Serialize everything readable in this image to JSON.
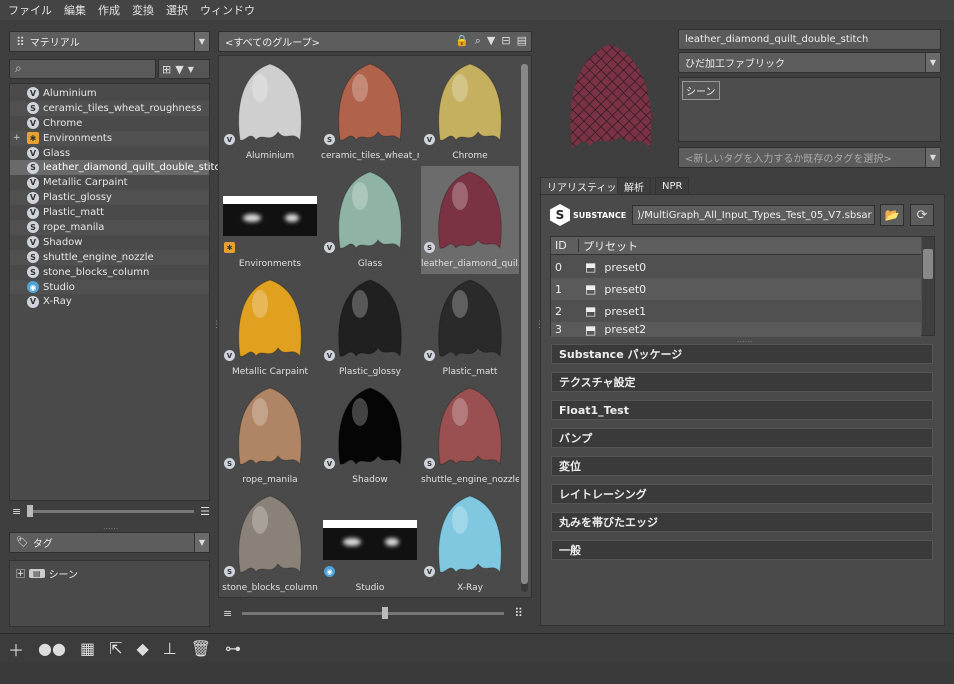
{
  "menu": [
    "ファイル",
    "編集",
    "作成",
    "変換",
    "選択",
    "ウィンドウ"
  ],
  "left": {
    "category": "マテリアル",
    "search_placeholder": "",
    "tree": [
      {
        "label": "Aluminium",
        "icon": "V"
      },
      {
        "label": "ceramic_tiles_wheat_roughness",
        "icon": "S"
      },
      {
        "label": "Chrome",
        "icon": "V"
      },
      {
        "label": "Environments",
        "icon": "env",
        "expand": "+"
      },
      {
        "label": "Glass",
        "icon": "V"
      },
      {
        "label": "leather_diamond_quilt_double_stitch",
        "icon": "S",
        "selected": true
      },
      {
        "label": "Metallic Carpaint",
        "icon": "V"
      },
      {
        "label": "Plastic_glossy",
        "icon": "V"
      },
      {
        "label": "Plastic_matt",
        "icon": "V"
      },
      {
        "label": "rope_manila",
        "icon": "S"
      },
      {
        "label": "Shadow",
        "icon": "V"
      },
      {
        "label": "shuttle_engine_nozzle",
        "icon": "S"
      },
      {
        "label": "stone_blocks_column",
        "icon": "S"
      },
      {
        "label": "Studio",
        "icon": "eye"
      },
      {
        "label": "X-Ray",
        "icon": "V"
      }
    ],
    "tag_dropdown": "タグ",
    "tag_tree_item": "シーン"
  },
  "middle": {
    "group_dropdown": "<すべてのグループ>",
    "tiles": [
      {
        "name": "Aluminium",
        "badge": "V",
        "color": "#cfcfcf"
      },
      {
        "name": "ceramic_tiles_wheat_r...",
        "badge": "S",
        "color": "#b0624a"
      },
      {
        "name": "Chrome",
        "badge": "V",
        "color": "#c5b060"
      },
      {
        "name": "Environments",
        "badge": "env",
        "color": "env"
      },
      {
        "name": "Glass",
        "badge": "V",
        "color": "#8fb3a4"
      },
      {
        "name": "leather_diamond_quil...",
        "badge": "S",
        "color": "#7b3344",
        "selected": true
      },
      {
        "name": "Metallic Carpaint",
        "badge": "V",
        "color": "#e0a020"
      },
      {
        "name": "Plastic_glossy",
        "badge": "V",
        "color": "#202020"
      },
      {
        "name": "Plastic_matt",
        "badge": "V",
        "color": "#2a2a2a"
      },
      {
        "name": "rope_manila",
        "badge": "S",
        "color": "#b08565"
      },
      {
        "name": "Shadow",
        "badge": "V",
        "color": "#050505"
      },
      {
        "name": "shuttle_engine_nozzle",
        "badge": "S",
        "color": "#9a5050"
      },
      {
        "name": "stone_blocks_column",
        "badge": "S",
        "color": "#8a8278"
      },
      {
        "name": "Studio",
        "badge": "eye",
        "color": "env"
      },
      {
        "name": "X-Ray",
        "badge": "V",
        "color": "#7fc8e0"
      }
    ]
  },
  "right": {
    "name_field": "leather_diamond_quilt_double_stitch",
    "category_dropdown": "ひだ加工ファブリック",
    "tag_chip": "シーン",
    "tag_input_placeholder": "<新しいタグを入力するか既存のタグを選択>",
    "tabs": [
      "リアリスティック",
      "解析",
      "NPR"
    ],
    "substance_logo": "SUBSTANCE",
    "sbsar_path": ")/MultiGraph_All_Input_Types_Test_05_V7.sbsar",
    "preset_headers": {
      "id": "ID",
      "name": "プリセット"
    },
    "presets": [
      {
        "id": "0",
        "name": "preset0"
      },
      {
        "id": "1",
        "name": "preset0"
      },
      {
        "id": "2",
        "name": "preset1"
      },
      {
        "id": "3",
        "name": "preset2"
      }
    ],
    "sections": [
      "Substance パッケージ",
      "テクスチャ設定",
      "Float1_Test",
      "バンプ",
      "変位",
      "レイトレーシング",
      "丸みを帯びたエッジ",
      "一般"
    ]
  },
  "colors": {
    "accent_blue": "#4fa3d8",
    "selection": "#6c6c6c"
  }
}
